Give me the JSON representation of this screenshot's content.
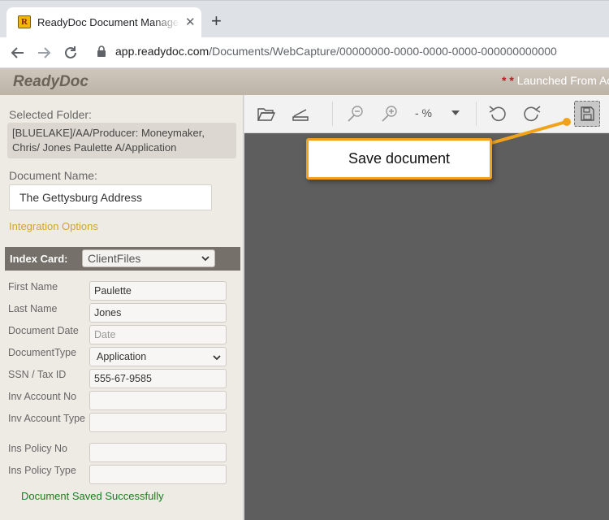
{
  "browser": {
    "tab_title": "ReadyDoc Document Management",
    "favicon_letter": "R",
    "url_host": "app.readydoc.com",
    "url_path": "/Documents/WebCapture/00000000-0000-0000-0000-000000000000"
  },
  "header": {
    "brand": "ReadyDoc",
    "launched_stars": "* *",
    "launched_text": "Launched From Ac"
  },
  "left_panel": {
    "selected_folder_label": "Selected Folder:",
    "folder_path": "[BLUELAKE]/AA/Producer: Moneymaker, Chris/ Jones Paulette A/Application",
    "document_name_label": "Document Name:",
    "document_name_value": "The Gettysburg Address",
    "integration_options": "Integration Options",
    "index_card_label": "Index Card:",
    "index_card_value": "ClientFiles",
    "fields": [
      {
        "label": "First Name",
        "value": "Paulette",
        "placeholder": ""
      },
      {
        "label": "Last Name",
        "value": "Jones",
        "placeholder": ""
      },
      {
        "label": "Document Date",
        "value": "",
        "placeholder": "Date"
      },
      {
        "label": "DocumentType",
        "value": "Application",
        "placeholder": ""
      },
      {
        "label": "SSN / Tax ID",
        "value": "555-67-9585",
        "placeholder": ""
      },
      {
        "label": "Inv Account No",
        "value": "",
        "placeholder": ""
      },
      {
        "label": "Inv Account Type",
        "value": "",
        "placeholder": ""
      },
      {
        "label": "Ins Policy No",
        "value": "",
        "placeholder": ""
      },
      {
        "label": "Ins Policy Type",
        "value": "",
        "placeholder": ""
      }
    ],
    "status_message": "Document Saved Successfully"
  },
  "viewer": {
    "zoom_text": "- %",
    "icons": [
      "folder-open-icon",
      "scanner-icon",
      "zoom-out-icon",
      "zoom-in-icon",
      "chevron-down-icon",
      "rotate-left-icon",
      "rotate-right-icon",
      "save-icon"
    ]
  },
  "callout": {
    "text": "Save document"
  },
  "colors": {
    "accent_orange": "#f0a31a",
    "header_brand": "#6b6258",
    "integration_link": "#d4a03a",
    "success_green": "#1f7a1f",
    "canvas_gray": "#5e5e5e"
  }
}
